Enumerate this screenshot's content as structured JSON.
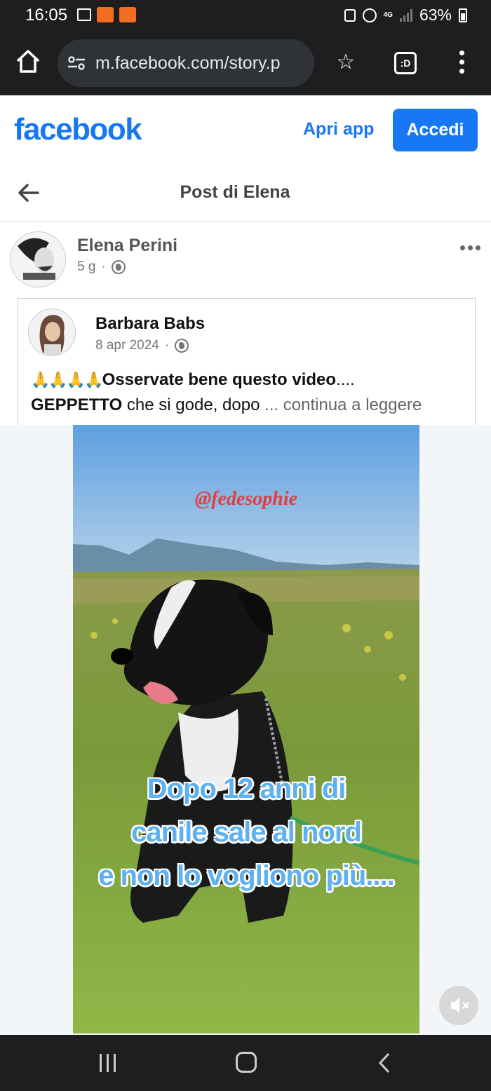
{
  "status_bar": {
    "time": "16:05",
    "network": "4G",
    "battery": "63%",
    "battery_level": 0.63,
    "notification_icons": [
      "gallery-icon",
      "temu-icon",
      "temu-icon"
    ]
  },
  "browser": {
    "url": "m.facebook.com/story.p",
    "tab_count_label": ":D"
  },
  "header": {
    "logo": "facebook",
    "open_app": "Apri app",
    "login": "Accedi",
    "brand_color": "#1877f2"
  },
  "page": {
    "title": "Post di Elena"
  },
  "post": {
    "author": "Elena Perini",
    "age": "5 g",
    "separator": "·"
  },
  "shared_post": {
    "author": "Barbara Babs",
    "date": "8 apr 2024",
    "separator": "·",
    "emojis": "🙏🙏🙏🙏",
    "headline": "Osservate bene questo video",
    "headline_trail": "....",
    "name_bold": "GEPPETTO",
    "text_rest": " che si gode, dopo ",
    "read_more": "... continua a leggere"
  },
  "video": {
    "handle": "@fedesophie",
    "caption_lines": [
      "Dopo 12 anni di",
      "canile sale al nord",
      "e non lo vogliono più...."
    ],
    "muted": true
  }
}
